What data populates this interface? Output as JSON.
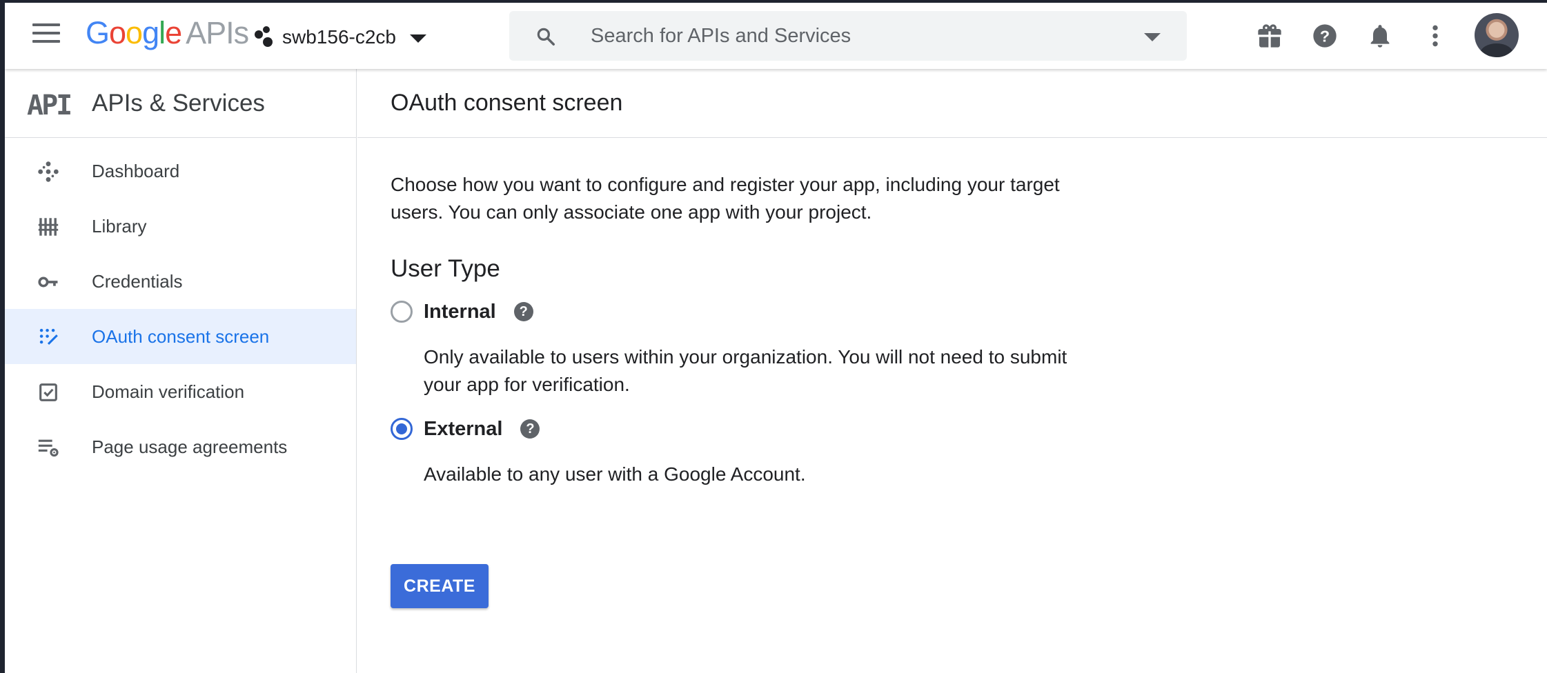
{
  "topbar": {
    "logo_google": "Google",
    "logo_apis": "APIs",
    "project_name": "swb156-c2cb",
    "search": {
      "placeholder": "Search for APIs and Services"
    },
    "icons": [
      "menu-icon",
      "project-icon",
      "search-icon",
      "gift-icon",
      "help-icon",
      "notifications-icon",
      "more-vert-icon",
      "avatar"
    ]
  },
  "sidebar": {
    "title": "APIs & Services",
    "items": [
      {
        "label": "Dashboard",
        "icon": "dashboard-icon"
      },
      {
        "label": "Library",
        "icon": "library-icon"
      },
      {
        "label": "Credentials",
        "icon": "key-icon"
      },
      {
        "label": "OAuth consent screen",
        "icon": "consent-icon",
        "active": true
      },
      {
        "label": "Domain verification",
        "icon": "checkbox-icon"
      },
      {
        "label": "Page usage agreements",
        "icon": "settings-list-icon"
      }
    ]
  },
  "main": {
    "page_title": "OAuth consent screen",
    "intro": "Choose how you want to configure and register your app, including your target users. You can only associate one app with your project.",
    "user_type_title": "User Type",
    "options": [
      {
        "label": "Internal",
        "selected": false,
        "description": "Only available to users within your organization. You will not need to submit your app for verification."
      },
      {
        "label": "External",
        "selected": true,
        "description": "Available to any user with a Google Account."
      }
    ],
    "help_glyph": "?",
    "create_label": "CREATE"
  },
  "colors": {
    "accent": "#3b6cd9",
    "active_nav_bg": "#e8f0fe",
    "active_nav_text": "#1a73e8"
  }
}
